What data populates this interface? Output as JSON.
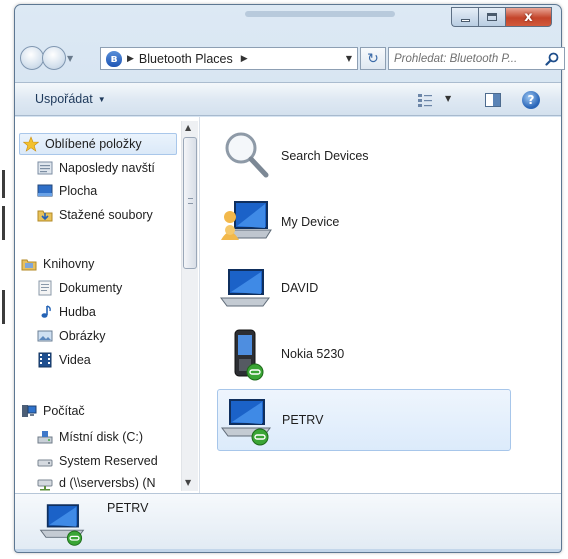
{
  "window": {
    "caption": {
      "minimize": "minimize",
      "maximize": "maximize",
      "close": "x"
    }
  },
  "address_bar": {
    "root_icon": "bluetooth-icon",
    "crumbs": [
      "Bluetooth Places"
    ]
  },
  "search": {
    "placeholder": "Prohledat: Bluetooth P..."
  },
  "command_bar": {
    "organize_label": "Uspořádat",
    "help_glyph": "?"
  },
  "nav_pane": {
    "favorites": {
      "label": "Oblíbené položky",
      "icon": "star-icon",
      "items": [
        {
          "label": "Naposledy navští",
          "icon": "recent-places-icon"
        },
        {
          "label": "Plocha",
          "icon": "desktop-icon"
        },
        {
          "label": "Stažené soubory",
          "icon": "downloads-icon"
        }
      ]
    },
    "libraries": {
      "label": "Knihovny",
      "icon": "libraries-icon",
      "items": [
        {
          "label": "Dokumenty",
          "icon": "documents-icon"
        },
        {
          "label": "Hudba",
          "icon": "music-icon"
        },
        {
          "label": "Obrázky",
          "icon": "pictures-icon"
        },
        {
          "label": "Videa",
          "icon": "videos-icon"
        }
      ]
    },
    "computer": {
      "label": "Počítač",
      "icon": "computer-icon",
      "items": [
        {
          "label": "Místní disk (C:)",
          "icon": "local-disk-icon"
        },
        {
          "label": "System Reserved",
          "icon": "drive-icon"
        },
        {
          "label": "d (\\\\serversbs) (N",
          "icon": "network-drive-icon"
        }
      ]
    }
  },
  "files": [
    {
      "label": "Search Devices",
      "icon": "search-devices-icon"
    },
    {
      "label": "My Device",
      "icon": "my-device-icon"
    },
    {
      "label": "DAVID",
      "icon": "laptop-icon"
    },
    {
      "label": "Nokia 5230",
      "icon": "phone-icon"
    },
    {
      "label": "PETRV",
      "icon": "laptop-connected-icon",
      "selected": true
    }
  ],
  "details_pane": {
    "name": "PETRV",
    "icon": "laptop-connected-icon"
  },
  "colors": {
    "selection_fill": "#dcebfb",
    "selection_border": "#a7c6ea",
    "frame": "#c9dbed",
    "close_button": "#c4442a"
  }
}
